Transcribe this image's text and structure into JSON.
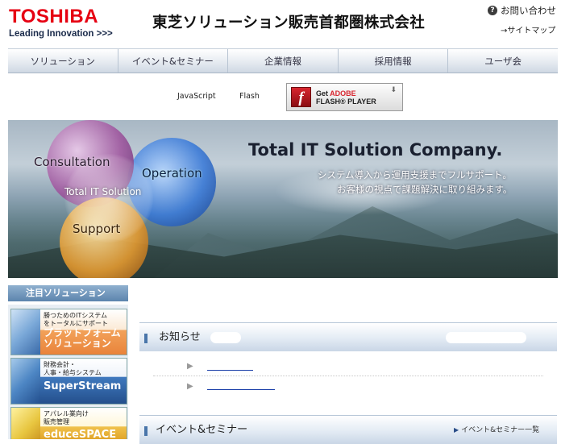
{
  "header": {
    "logo": "TOSHIBA",
    "tagline": "Leading Innovation >>>",
    "company_name": "東芝ソリューション販売首都圏株式会社",
    "contact_label": "お問い合わせ",
    "sitemap_label": "→サイトマップ"
  },
  "nav": {
    "items": [
      {
        "label": "ソリューション"
      },
      {
        "label": "イベント&セミナー"
      },
      {
        "label": "企業情報"
      },
      {
        "label": "採用情報"
      },
      {
        "label": "ユーザ会"
      }
    ]
  },
  "plugins": {
    "javascript_label": "JavaScript",
    "flash_label": "Flash",
    "flash_badge_line1_prefix": "Get ",
    "flash_badge_line1_brand": "ADOBE",
    "flash_badge_line2": "FLASH® PLAYER"
  },
  "hero": {
    "title": "Total IT Solution Company.",
    "subtitle_line1": "システム導入から運用支援までフルサポート。",
    "subtitle_line2": "お客様の視点で課題解決に取り組みます。",
    "circles": {
      "consultation": "Consultation",
      "operation": "Operation",
      "center": "Total IT Solution",
      "support": "Support"
    }
  },
  "featured": {
    "header": "注目ソリューション",
    "banners": [
      {
        "small_line1": "勝つためのITシステム",
        "small_line2": "をトータルにサポート",
        "big_line1": "プラットフォーム",
        "big_line2": "ソリューション"
      },
      {
        "small_line1": "財務会計・",
        "small_line2": "人事・給与システム",
        "big_line1": "SuperStream",
        "big_line2": ""
      },
      {
        "small_line1": "アパレル業向け",
        "small_line2": "販売管理",
        "big_line1": "educeSPACE",
        "big_line2": ""
      }
    ]
  },
  "news": {
    "title": "お知らせ",
    "arrow": "▶"
  },
  "events": {
    "title": "イベント&セミナー",
    "list_link": "イベント&セミナー一覧",
    "arrow": "▶"
  },
  "colors": {
    "brand_red": "#e60012",
    "nav_border": "#a8b6c6",
    "link_blue": "#1a3ea8"
  }
}
